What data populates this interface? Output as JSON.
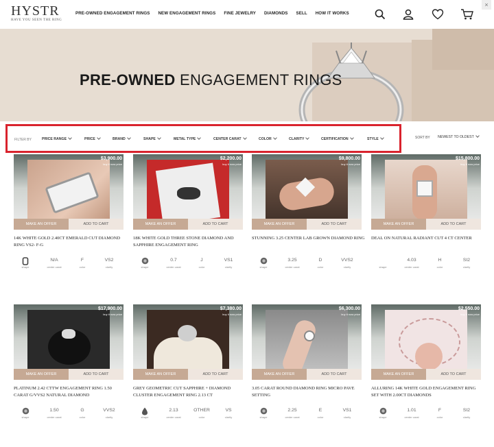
{
  "header": {
    "logo": "HYSTR",
    "logo_tagline": "HAVE YOU SEEN THE RING",
    "nav": [
      "PRE-OWNED ENGAGEMENT RINGS",
      "NEW ENGAGEMENT RINGS",
      "FINE JEWELRY",
      "DIAMONDS",
      "SELL",
      "HOW IT WORKS"
    ],
    "close": "×"
  },
  "hero": {
    "title_bold": "PRE-OWNED",
    "title_rest": " ENGAGEMENT RINGS"
  },
  "filters": {
    "label": "FILTER BY",
    "items": [
      "PRICE RANGE",
      "PRICE",
      "BRAND",
      "SHAPE",
      "METAL TYPE",
      "CENTER CARAT",
      "COLOR",
      "CLARITY",
      "CERTIFICATION",
      "STYLE"
    ],
    "sort_label": "SORT BY",
    "sort_value": "NEWEST TO OLDEST"
  },
  "labels": {
    "make_offer": "MAKE AN OFFER",
    "add_to_cart": "ADD TO CART",
    "buy_now": "buy it now price",
    "shape": "shape",
    "center_carat": "center carat",
    "color": "color",
    "clarity": "clarity"
  },
  "products": [
    {
      "price": "$3,900.00",
      "title": "14K WHITE GOLD 2.40CT EMERALD CUT DIAMOND RING VS2- F-G",
      "shape": "emerald",
      "carat": "N/A",
      "color": "F",
      "clarity": "VS2"
    },
    {
      "price": "$2,200.00",
      "title": "18K WHITE GOLD THREE STONE DIAMOND AND SAPPHIRE ENGAGEMENT RING",
      "shape": "round",
      "carat": "0.7",
      "color": "J",
      "clarity": "VS1"
    },
    {
      "price": "$9,800.00",
      "title": "STUNNING 3.25 CENTER LAB GROWN DIAMOND RING",
      "shape": "round",
      "carat": "3.25",
      "color": "D",
      "clarity": "VVS2"
    },
    {
      "price": "$15,800.00",
      "title": "DEAL ON NATURAL RADIANT CUT 4 CT CENTER",
      "shape": "none",
      "carat": "4.03",
      "color": "H",
      "clarity": "SI2"
    },
    {
      "price": "$17,900.00",
      "title": "PLATINUM 2.42 CTTW ENGAGEMENT RING 1.50 CARAT G/VVS2 NATURAL DIAMOND",
      "shape": "round",
      "carat": "1.50",
      "color": "G",
      "clarity": "VVS2"
    },
    {
      "price": "$7,380.00",
      "title": "GREY GEOMETRIC CUT SAPPHIRE + DIAMOND CLUSTER ENGAGEMENT RING 2.13 CT",
      "shape": "pear",
      "carat": "2.13",
      "color": "OTHER",
      "clarity": "VS"
    },
    {
      "price": "$6,300.00",
      "title": "3.05 CARAT ROUND DIAMOND RING MICRO PAVE SETTING",
      "shape": "round",
      "carat": "2.25",
      "color": "E",
      "clarity": "VS1"
    },
    {
      "price": "$2,550.00",
      "title": "ALLURING 14K WHITE GOLD ENGAGEMENT RING SET WITH 2.00CT DIAMONDS",
      "shape": "round",
      "carat": "1.01",
      "color": "F",
      "clarity": "SI2"
    }
  ]
}
